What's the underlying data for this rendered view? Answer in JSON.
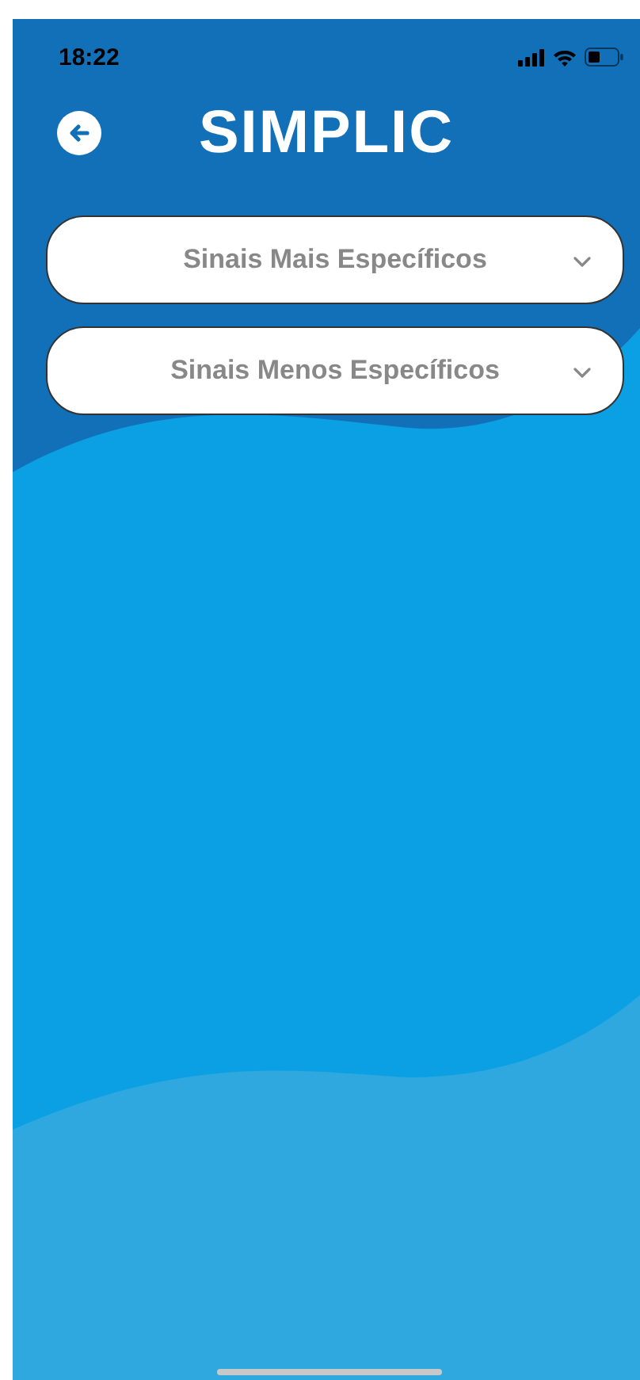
{
  "status_bar": {
    "time": "18:22"
  },
  "header": {
    "title": "SIMPLIC"
  },
  "sections": [
    {
      "label": "Sinais Mais Específicos",
      "expanded": false
    },
    {
      "label": "Sinais Menos Específicos",
      "expanded": false
    }
  ]
}
